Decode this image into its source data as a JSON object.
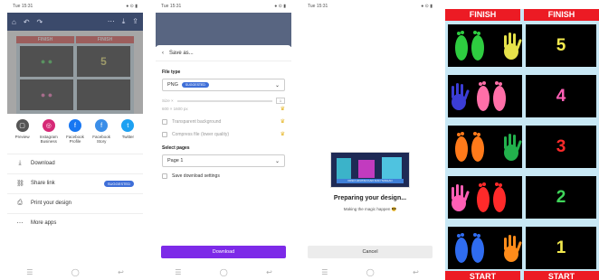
{
  "phone1": {
    "status_time": "Tue 15:31",
    "status_right": "● ⊙ ▮",
    "share_targets": [
      {
        "label": "Preview",
        "icon": "preview-icon",
        "color": "#555"
      },
      {
        "label": "Instagram Business",
        "icon": "instagram-icon",
        "color": "#d62976"
      },
      {
        "label": "Facebook Profile",
        "icon": "facebook-icon",
        "color": "#1877f2"
      },
      {
        "label": "Facebook Story",
        "icon": "facebook-story-icon",
        "color": "#3b8ee8"
      },
      {
        "label": "Twitter",
        "icon": "twitter-icon",
        "color": "#1da1f2"
      }
    ],
    "menu": [
      {
        "label": "Download",
        "icon": "download-icon"
      },
      {
        "label": "Share link",
        "icon": "link-icon",
        "badge": "SUGGESTED"
      },
      {
        "label": "Print your design",
        "icon": "print-icon"
      },
      {
        "label": "More apps",
        "icon": "more-icon"
      }
    ],
    "preview_finish": "FINISH",
    "preview_number": "5"
  },
  "phone2": {
    "status_time": "Tue 15:31",
    "header": "Save as...",
    "file_type_label": "File type",
    "file_type_value": "PNG",
    "file_type_badge": "SUGGESTED",
    "size_label": "Size ×",
    "size_value": "1",
    "size_dims": "600 × 1600 px",
    "transparent_bg": "Transparent background",
    "compress": "Compress file (lower quality)",
    "select_pages_label": "Select pages",
    "select_pages_value": "Page 1",
    "save_settings": "Save download settings",
    "download_button": "Download"
  },
  "phone3": {
    "status_time": "Tue 15:31",
    "banner": "PASO URUTAN KAKI DAN TANGAN",
    "title": "Preparing your design...",
    "subtitle": "Making the magic happen 😎",
    "cancel_button": "Cancel"
  },
  "board": {
    "top_left": "FINISH",
    "top_right": "FINISH",
    "bottom_left": "START",
    "bottom_right": "START",
    "rows": [
      {
        "number": "5",
        "num_color": "#f2e94e",
        "left_color": "#2ecc40",
        "right_color": "#e6e24a"
      },
      {
        "number": "4",
        "num_color": "#ff5fb5",
        "left_color": "#3b3dd6",
        "right_color": "#ff6fa8"
      },
      {
        "number": "3",
        "num_color": "#ff2a2a",
        "left_color": "#ff7a1a",
        "right_color": "#22b14c"
      },
      {
        "number": "2",
        "num_color": "#3fd65a",
        "left_color": "#ff5fb5",
        "right_color": "#ff2a2a"
      },
      {
        "number": "1",
        "num_color": "#f2e94e",
        "left_color": "#2f6cf0",
        "right_color": "#ff8c1a"
      }
    ]
  }
}
